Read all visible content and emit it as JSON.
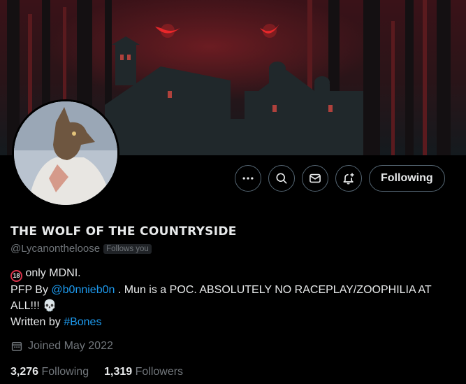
{
  "profile": {
    "display_name": "THE WOLF OF THE COUNTRYSIDE",
    "handle": "@Lycanontheloose",
    "follows_you_badge": "Follows you",
    "bio": {
      "line1_badge": "18",
      "line1_text": "only MDNI.",
      "line2_prefix": "PFP By",
      "line2_mention": "@b0nnieb0n",
      "line2_rest": ". Mun is a POC. ABSOLUTELY NO RACEPLAY/ZOOPHILIA AT ALL!!!",
      "line3_prefix": "Written by",
      "line3_hashtag": "#Bones"
    },
    "joined": "Joined May 2022",
    "following_count": "3,276",
    "following_label": "Following",
    "followers_count": "1,319",
    "followers_label": "Followers"
  },
  "actions": {
    "follow_button_label": "Following",
    "icons": [
      "more-icon",
      "search-icon",
      "message-icon",
      "notify-icon"
    ]
  },
  "colors": {
    "background": "#000000",
    "text": "#e7e9ea",
    "muted": "#71767b",
    "link": "#1d9bf0",
    "border": "#536471"
  }
}
